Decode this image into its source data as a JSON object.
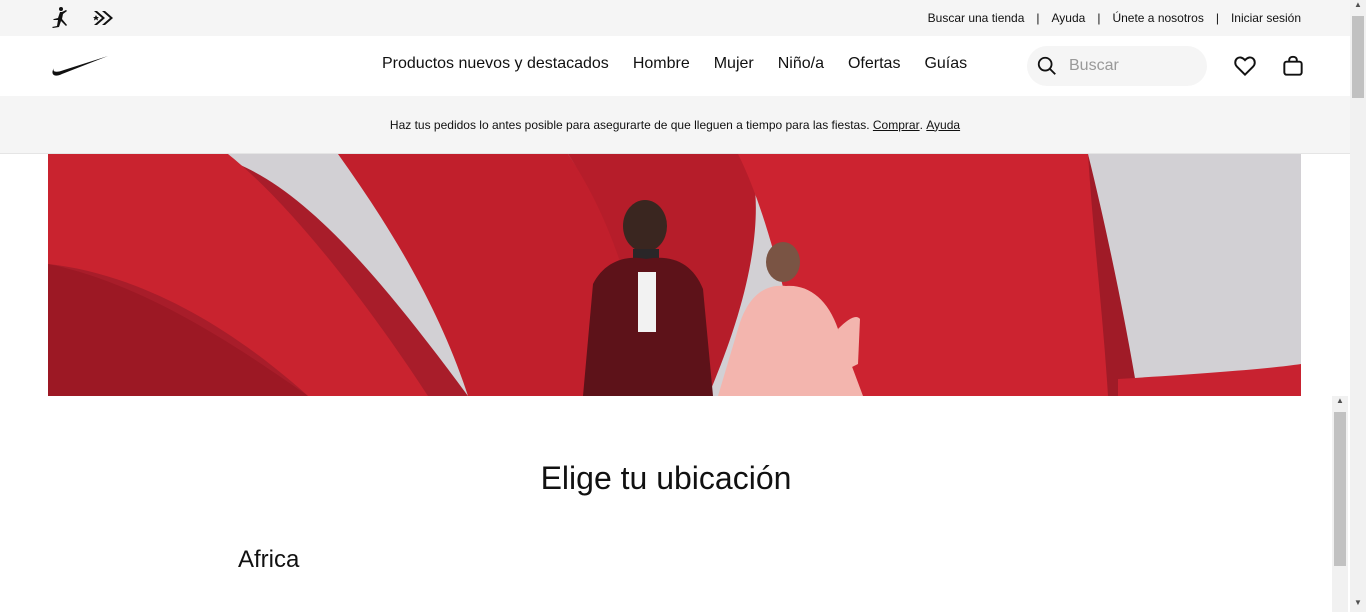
{
  "utility_bar": {
    "brand_icons": [
      "jordan-jumpman-icon",
      "converse-icon"
    ],
    "links": [
      "Buscar una tienda",
      "Ayuda",
      "Únete a nosotros",
      "Iniciar sesión"
    ],
    "separator": "|"
  },
  "header": {
    "logo": "nike-swoosh-icon",
    "nav": [
      "Productos nuevos y destacados",
      "Hombre",
      "Mujer",
      "Niño/a",
      "Ofertas",
      "Guías"
    ],
    "search": {
      "placeholder": "Buscar",
      "value": "",
      "icon": "search-icon"
    },
    "favorites_icon": "heart-icon",
    "bag_icon": "bag-icon"
  },
  "announcement": {
    "text": "Haz tus pedidos lo antes posible para asegurarte de que lleguen a tiempo para las fiestas.",
    "link_shop": "Comprar",
    "punct": ".",
    "link_help": "Ayuda"
  },
  "hero": {
    "image": "hero-photo-two-runners-red-fabric",
    "colors": {
      "red": "#c8202b",
      "dark_red": "#8e1a24",
      "background": "#d6d4d7"
    }
  },
  "main": {
    "title": "Elige tu ubicación",
    "regions": [
      "Africa"
    ]
  },
  "colors": {
    "text": "#111111",
    "utility_bg": "#f5f5f5"
  }
}
